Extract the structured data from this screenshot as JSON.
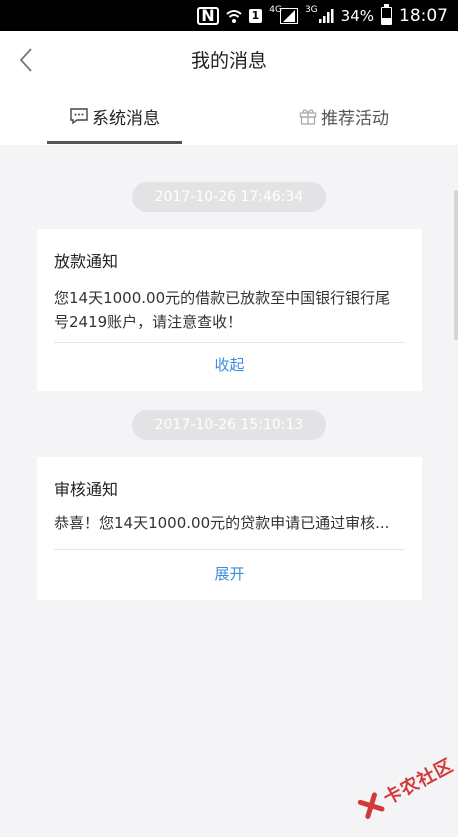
{
  "status_bar": {
    "nfc": "N",
    "sim": "1",
    "net1": "4G",
    "net2": "3G",
    "battery_percent": "34%",
    "time": "18:07"
  },
  "header": {
    "title": "我的消息"
  },
  "tabs": [
    {
      "label": "系统消息",
      "icon": "chat-bubble-icon",
      "active": true
    },
    {
      "label": "推荐活动",
      "icon": "gift-icon",
      "active": false
    }
  ],
  "messages": [
    {
      "time": "2017-10-26 17:46:34",
      "title": "放款通知",
      "body": "您14天1000.00元的借款已放款至中国银行银行尾号2419账户，请注意查收！",
      "action": "收起"
    },
    {
      "time": "2017-10-26 15:10:13",
      "title": "审核通知",
      "body": "恭喜！您14天1000.00元的贷款申请已通过审核...",
      "action": "展开"
    }
  ],
  "watermark": {
    "text": "卡农社区"
  },
  "colors": {
    "accent": "#3d8ddc",
    "watermark": "#d23a3a"
  }
}
